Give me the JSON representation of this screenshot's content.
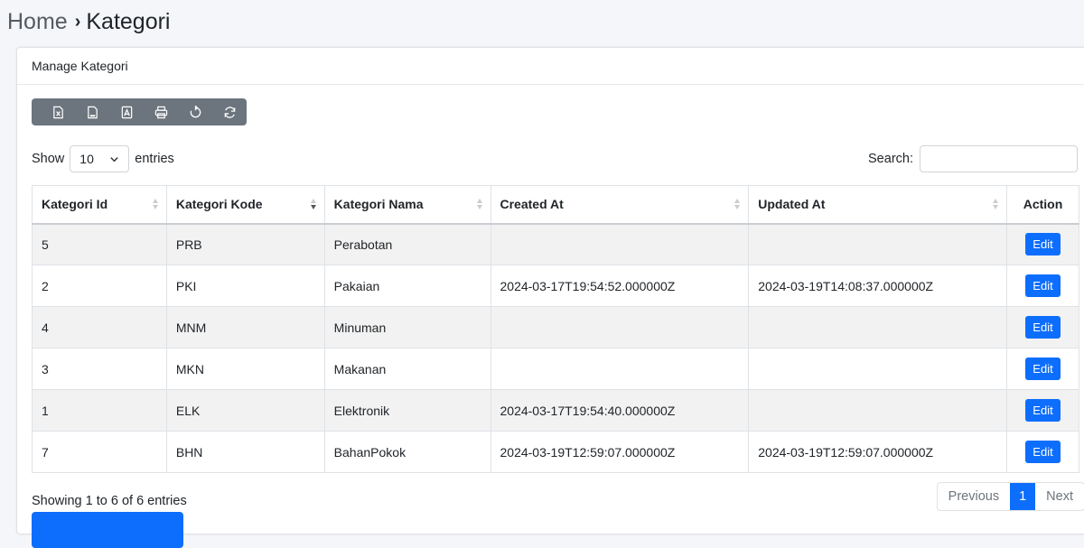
{
  "breadcrumb": {
    "home": "Home",
    "separator": "›",
    "current": "Kategori"
  },
  "card": {
    "title": "Manage Kategori"
  },
  "toolbar": {
    "buttons": [
      "excel-icon",
      "csv-icon",
      "pdf-icon",
      "print-icon",
      "reload-icon",
      "refresh-icon"
    ],
    "background": "#6c757d"
  },
  "length_menu": {
    "show_label": "Show",
    "selected": "10",
    "entries_label": "entries"
  },
  "search": {
    "label": "Search:",
    "value": "",
    "placeholder": ""
  },
  "table": {
    "columns": [
      "Kategori Id",
      "Kategori Kode",
      "Kategori Nama",
      "Created At",
      "Updated At",
      "Action"
    ],
    "rows": [
      {
        "id": "5",
        "kode": "PRB",
        "nama": "Perabotan",
        "created": "",
        "updated": "",
        "action": "Edit"
      },
      {
        "id": "2",
        "kode": "PKI",
        "nama": "Pakaian",
        "created": "2024-03-17T19:54:52.000000Z",
        "updated": "2024-03-19T14:08:37.000000Z",
        "action": "Edit"
      },
      {
        "id": "4",
        "kode": "MNM",
        "nama": "Minuman",
        "created": "",
        "updated": "",
        "action": "Edit"
      },
      {
        "id": "3",
        "kode": "MKN",
        "nama": "Makanan",
        "created": "",
        "updated": "",
        "action": "Edit"
      },
      {
        "id": "1",
        "kode": "ELK",
        "nama": "Elektronik",
        "created": "2024-03-17T19:54:40.000000Z",
        "updated": "",
        "action": "Edit"
      },
      {
        "id": "7",
        "kode": "BHN",
        "nama": "BahanPokok",
        "created": "2024-03-19T12:59:07.000000Z",
        "updated": "2024-03-19T12:59:07.000000Z",
        "action": "Edit"
      }
    ]
  },
  "info": "Showing 1 to 6 of 6 entries",
  "pagination": {
    "previous": "Previous",
    "current": "1",
    "next": "Next"
  },
  "colors": {
    "primary": "#0d6efd",
    "toolbar": "#6c757d",
    "striped_row": "#f2f2f2"
  }
}
